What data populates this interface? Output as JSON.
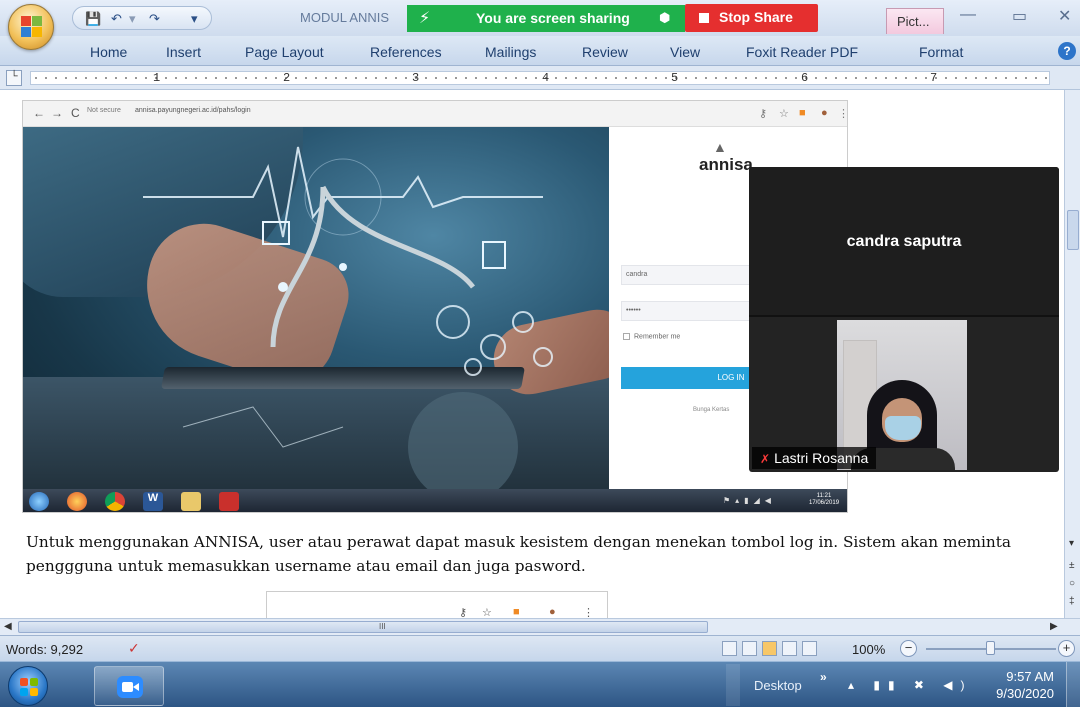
{
  "window": {
    "doc_title": "MODUL ANNIS",
    "context_tab": "Pict...",
    "min": "—",
    "max": "▭",
    "close": "✕"
  },
  "share": {
    "status_text": "You are screen sharing",
    "stop_label": "Stop Share",
    "color_green": "#1fb14c",
    "color_red": "#e52f2f"
  },
  "ribbon": {
    "tabs": [
      "Home",
      "Insert",
      "Page Layout",
      "References",
      "Mailings",
      "Review",
      "View",
      "Foxit Reader PDF",
      "Format"
    ]
  },
  "ruler": {
    "numbers": [
      "1",
      "2",
      "3",
      "4",
      "5",
      "6",
      "7"
    ]
  },
  "embedded_screenshot": {
    "url": "annisa.payungnegeri.ac.id/pahs/login",
    "url_prefix": "Not secure",
    "app_name": "annisa",
    "username_value": "candra",
    "password_value": "••••••",
    "remember_label": "Remember me",
    "login_label": "LOG IN",
    "footer_text": "Bunga Kertas",
    "tray_time": "11:21",
    "tray_date": "17/06/2019"
  },
  "zoom_overlay": {
    "presenter_name": "candra saputra",
    "participant_name": "Lastri Rosanna"
  },
  "document": {
    "paragraph": "Untuk menggunakan ANNISA, user atau perawat dapat masuk kesistem dengan menekan tombol log in. Sistem akan meminta penggguna untuk memasukkan username atau email dan juga pasword."
  },
  "statusbar": {
    "words": "Words: 9,292",
    "zoom_level": "100%",
    "scroll_grip": "III"
  },
  "taskbar": {
    "desktop_label": "Desktop",
    "chevron": "»",
    "time": "9:57 AM",
    "date": "9/30/2020"
  },
  "icons": {
    "office": "office-button-icon",
    "save": "save-icon",
    "undo": "undo-icon",
    "redo": "redo-icon",
    "help": "help-icon",
    "zoom_app": "zoom-app-icon",
    "start": "windows-start-icon"
  }
}
